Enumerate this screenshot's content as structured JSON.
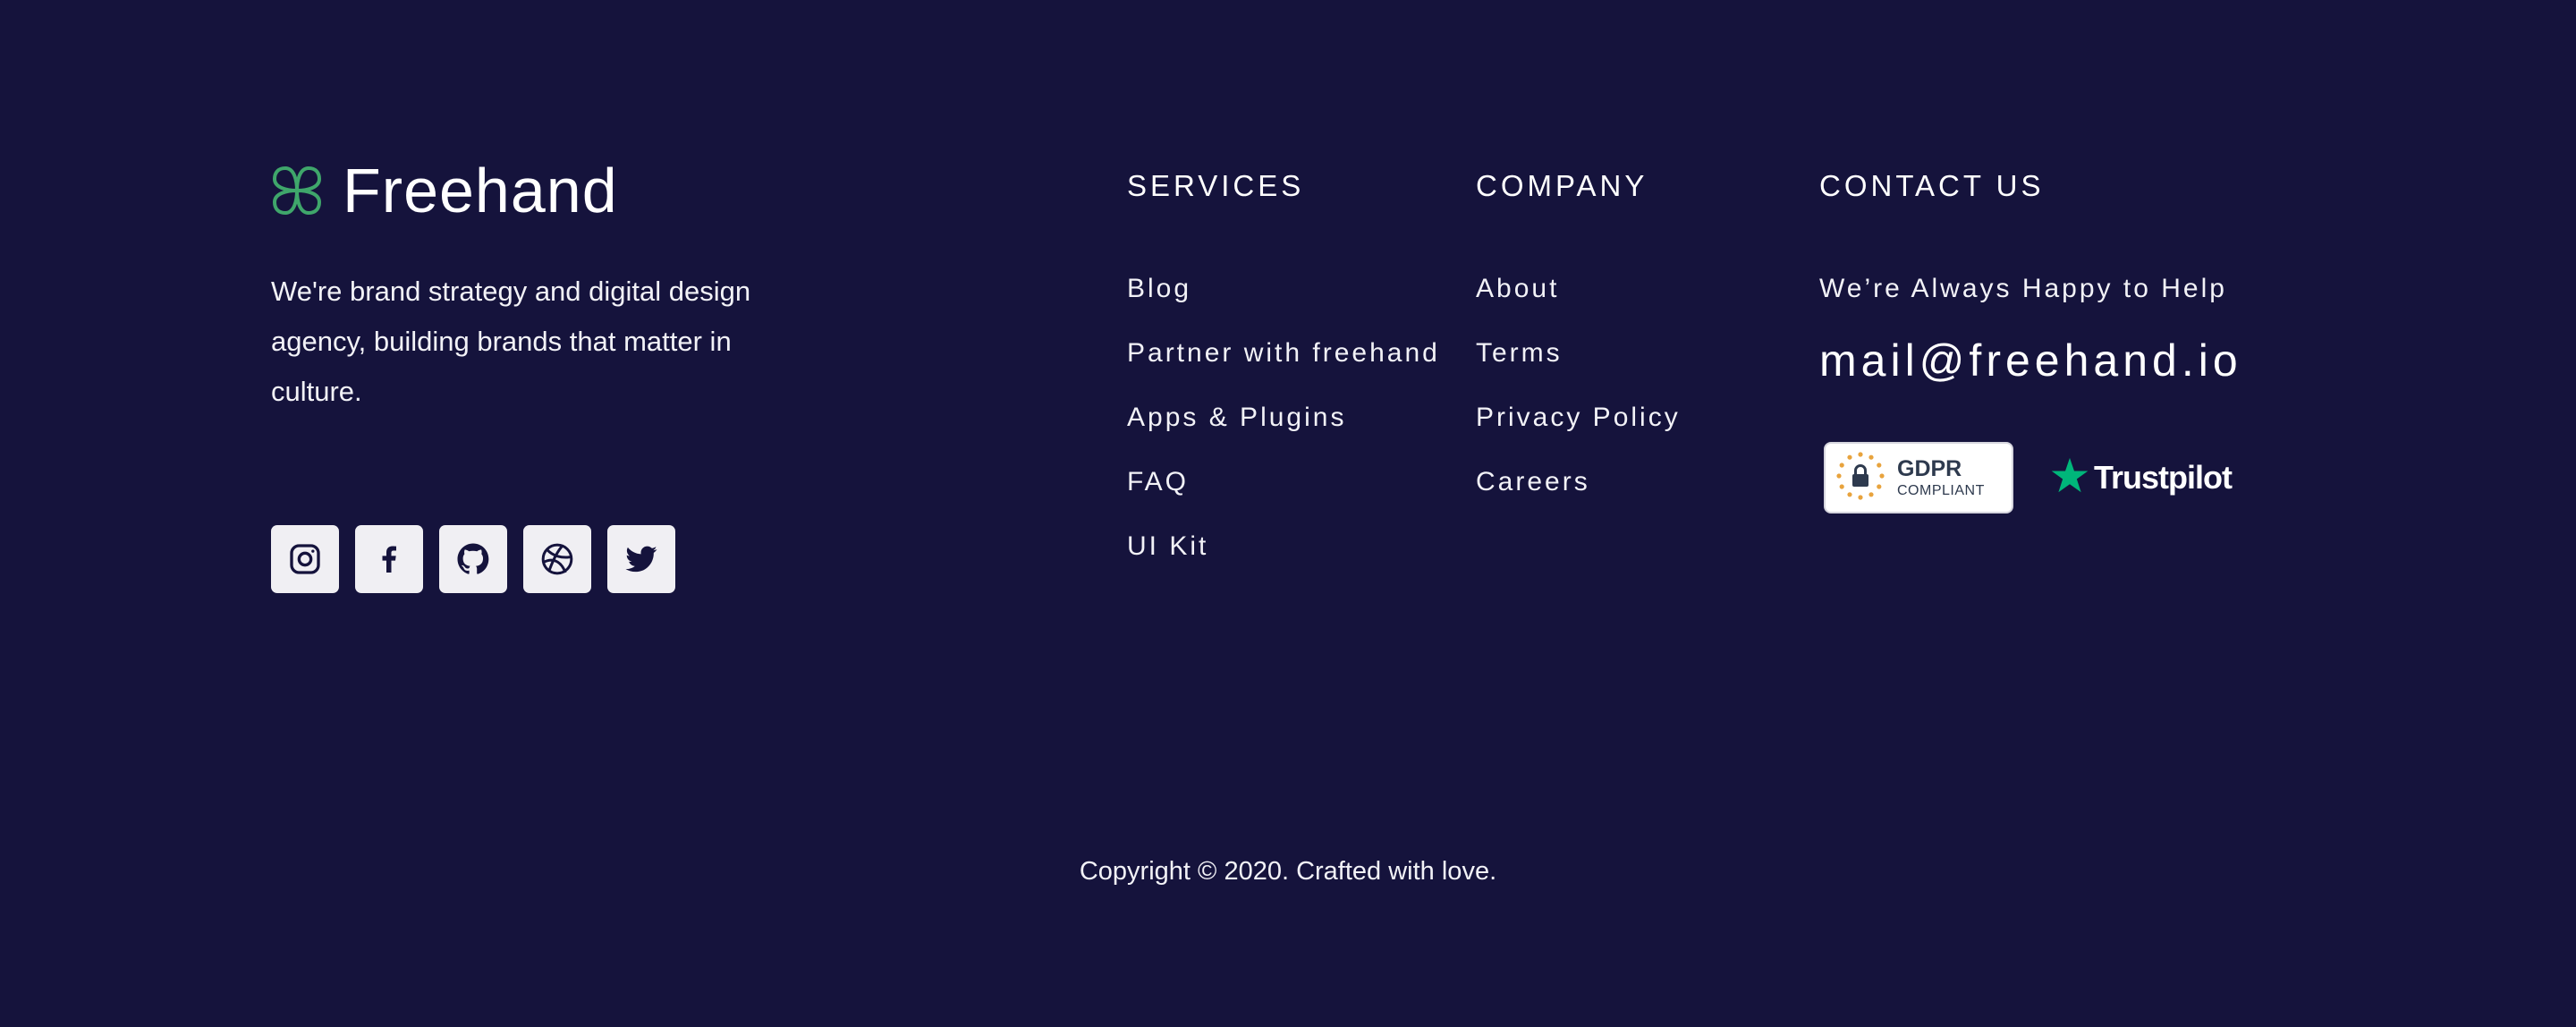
{
  "brand": {
    "name": "Freehand",
    "tagline": "We're brand strategy and digital design agency, building brands that matter in culture.",
    "accent_color": "#3FA66B"
  },
  "socials": [
    {
      "name": "instagram-icon"
    },
    {
      "name": "facebook-icon"
    },
    {
      "name": "github-icon"
    },
    {
      "name": "dribbble-icon"
    },
    {
      "name": "twitter-icon"
    }
  ],
  "services": {
    "title": "SERVICES",
    "links": [
      "Blog",
      "Partner with freehand",
      "Apps & Plugins",
      "FAQ",
      "UI Kit"
    ]
  },
  "company": {
    "title": "COMPANY",
    "links": [
      "About",
      "Terms",
      "Privacy Policy",
      "Careers"
    ]
  },
  "contact": {
    "title": "CONTACT US",
    "subtitle": "We’re Always Happy to Help",
    "email": "mail@freehand.io"
  },
  "badges": {
    "gdpr_title": "GDPR",
    "gdpr_sub": "COMPLIANT",
    "trustpilot": "Trustpilot",
    "trustpilot_color": "#00B67A"
  },
  "copyright": "Copyright © 2020. Crafted with love.",
  "colors": {
    "background": "#15133C",
    "text": "#FFFFFF",
    "social_bg": "#F0EFF3"
  }
}
